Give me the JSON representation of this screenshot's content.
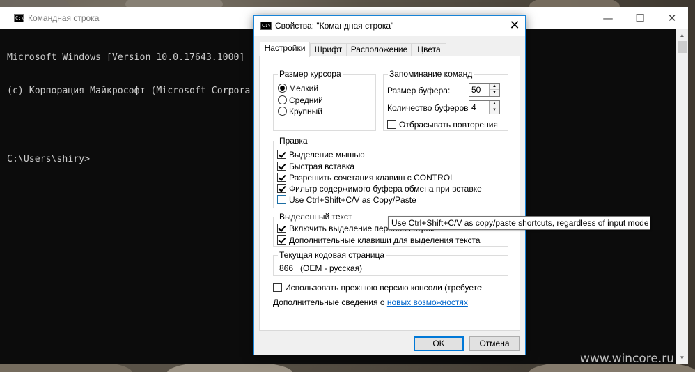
{
  "console": {
    "title": "Командная строка",
    "icon": "console-icon",
    "controls": {
      "minimize": "—",
      "maximize": "☐",
      "close": "✕"
    },
    "lines": [
      "Microsoft Windows [Version 10.0.17643.1000]",
      "(c) Корпорация Майкрософт (Microsoft Corpora",
      "",
      "C:\\Users\\shiry>"
    ]
  },
  "dialog": {
    "title": "Свойства: \"Командная строка\"",
    "close": "✕",
    "tabs": [
      "Настройки",
      "Шрифт",
      "Расположение",
      "Цвета"
    ],
    "cursor_size": {
      "label": "Размер курсора",
      "options": [
        "Мелкий",
        "Средний",
        "Крупный"
      ],
      "selected": "Мелкий"
    },
    "history": {
      "label": "Запоминание команд",
      "buffer_size_label": "Размер буфера:",
      "buffer_size_value": "50",
      "buffer_count_label": "Количество буферов:",
      "buffer_count_value": "4",
      "discard_duplicates_label": "Отбрасывать повторения"
    },
    "edit": {
      "label": "Правка",
      "options": [
        {
          "label": "Выделение мышью",
          "checked": true
        },
        {
          "label": "Быстрая вставка",
          "checked": true
        },
        {
          "label": "Разрешить сочетания клавиш с CONTROL",
          "checked": true
        },
        {
          "label": "Фильтр содержимого буфера обмена при вставке",
          "checked": true
        },
        {
          "label": "Use Ctrl+Shift+C/V as Copy/Paste",
          "checked": false
        }
      ]
    },
    "selection": {
      "label": "Выделенный текст",
      "options": [
        {
          "label": "Включить выделение переноса строк",
          "checked": true
        },
        {
          "label": "Дополнительные клавиши для выделения текста",
          "checked": true
        }
      ]
    },
    "codepage": {
      "label": "Текущая кодовая страница",
      "value": "866   (OEM - русская)"
    },
    "legacy_label": "Использовать прежнюю версию консоли (требуется пер",
    "more_info_prefix": "Дополнительные сведения о ",
    "more_info_link": "новых возможностях",
    "ok": "OK",
    "cancel": "Отмена"
  },
  "tooltip": "Use Ctrl+Shift+C/V as copy/paste shortcuts, regardless of input mode",
  "watermark": "www.wincore.ru"
}
